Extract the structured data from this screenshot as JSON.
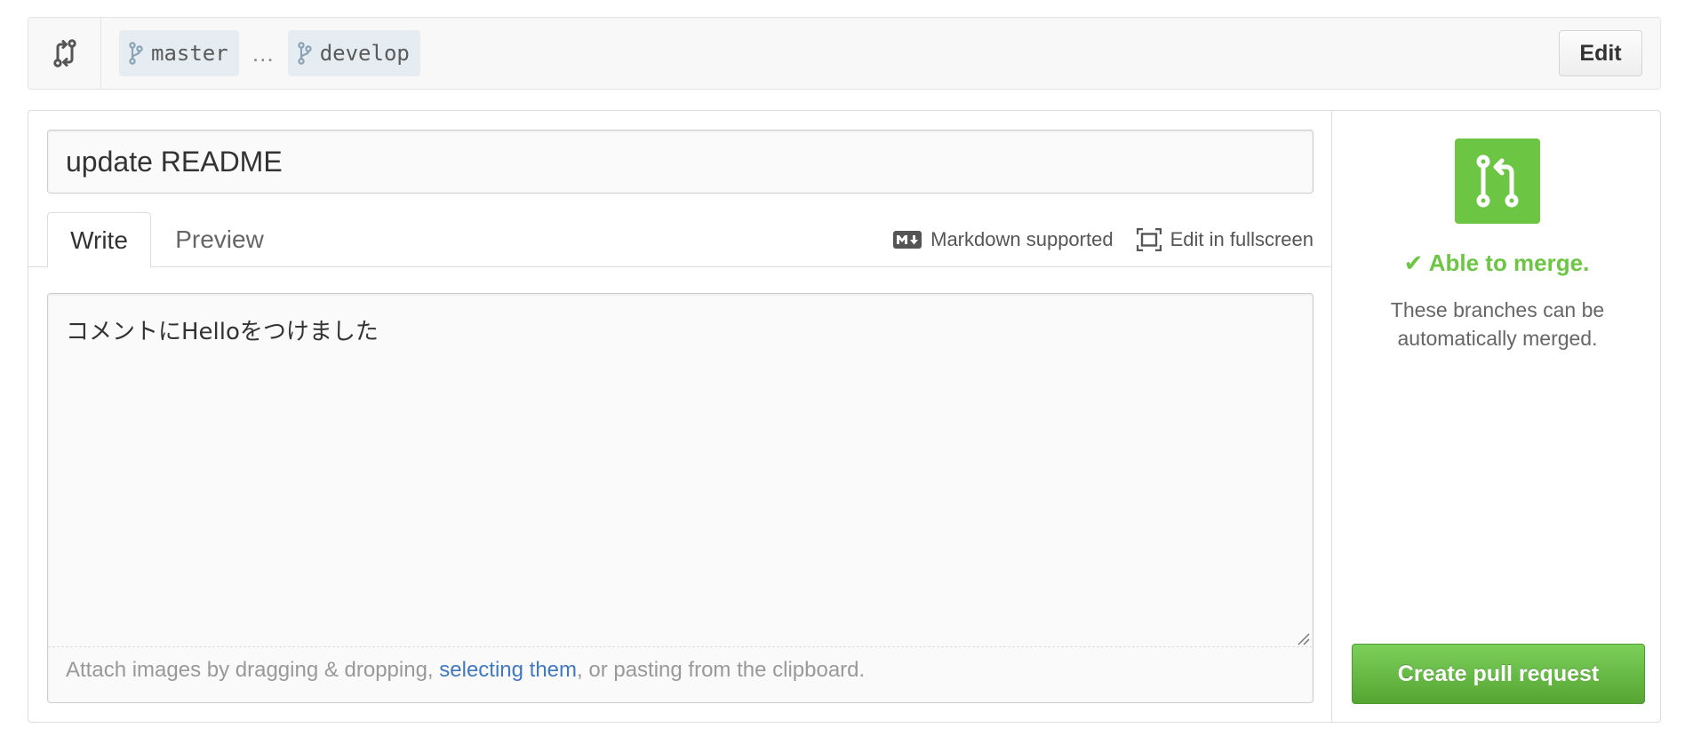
{
  "compare": {
    "base_branch": "master",
    "separator": "…",
    "head_branch": "develop",
    "edit_label": "Edit",
    "icons": {
      "compare": "git-compare-icon",
      "branch": "git-branch-icon"
    }
  },
  "form": {
    "title_value": "update README",
    "tabs": [
      {
        "label": "Write",
        "active": true
      },
      {
        "label": "Preview",
        "active": false
      }
    ],
    "markdown_label": "Markdown supported",
    "fullscreen_label": "Edit in fullscreen",
    "comment_value": "コメントにHelloをつけました",
    "attach_hint": {
      "prefix": "Attach images by dragging & dropping, ",
      "link": "selecting them",
      "suffix": ", or pasting from the clipboard."
    }
  },
  "sidebar": {
    "status": "✔ Able to merge.",
    "description": "These branches can be automatically merged.",
    "create_label": "Create pull request",
    "icon": "git-pull-request-icon"
  },
  "colors": {
    "success": "#6cc644",
    "link": "#4078c0",
    "branch_bg": "#e5edf2"
  }
}
